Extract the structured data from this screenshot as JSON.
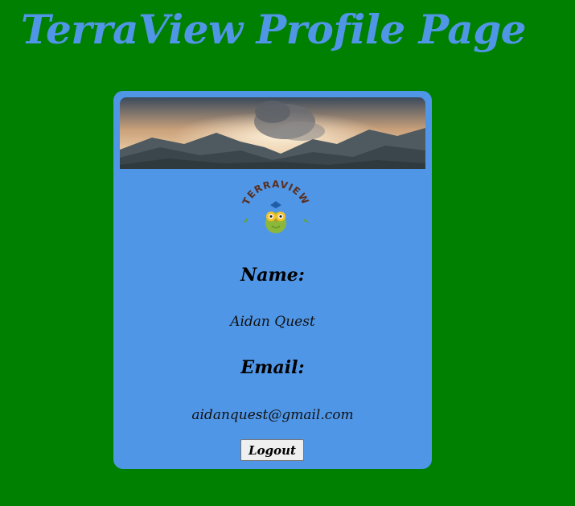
{
  "page": {
    "title": "TerraView Profile Page",
    "background_color": "#008000",
    "accent_color": "#5096e6"
  },
  "card": {
    "banner_image": "mountain-sunrise-banner",
    "logo": {
      "text": "TERRAVIEW",
      "icon": "owl-logo"
    },
    "name_label": "Name:",
    "name_value": "Aidan Quest",
    "email_label": "Email:",
    "email_value": "aidanquest@gmail.com",
    "logout_label": "Logout"
  }
}
